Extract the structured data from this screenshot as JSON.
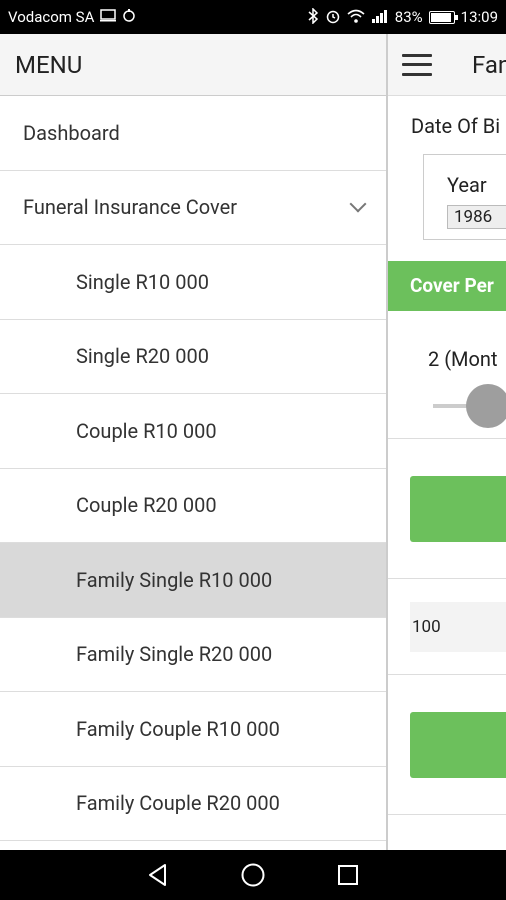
{
  "status_bar": {
    "carrier": "Vodacom SA",
    "battery_percent": "83%",
    "battery_level": 0.83,
    "time": "13:09",
    "icons": [
      "screen-icon",
      "android-icon",
      "bluetooth-icon",
      "alarm-icon",
      "wifi-icon",
      "signal-icon",
      "battery-icon"
    ]
  },
  "main": {
    "app_title": "Fan",
    "dob_label": "Date Of Bi",
    "year_label": "Year",
    "year_value": "1986",
    "cover_period_label": "Cover Per",
    "months_label": "2 (Mont",
    "amount_value": "100"
  },
  "drawer": {
    "title": "MENU",
    "items": [
      {
        "label": "Dashboard",
        "sub": false
      },
      {
        "label": "Funeral Insurance Cover",
        "sub": false,
        "expandable": true
      },
      {
        "label": "Single R10 000",
        "sub": true
      },
      {
        "label": "Single R20 000",
        "sub": true
      },
      {
        "label": "Couple R10 000",
        "sub": true
      },
      {
        "label": "Couple R20 000",
        "sub": true
      },
      {
        "label": "Family Single R10 000",
        "sub": true,
        "active": true
      },
      {
        "label": "Family Single R20 000",
        "sub": true
      },
      {
        "label": "Family Couple R10 000",
        "sub": true
      },
      {
        "label": "Family Couple R20 000",
        "sub": true
      }
    ]
  },
  "colors": {
    "accent_green": "#6cc05c",
    "active_item_bg": "#d9d9d9"
  }
}
